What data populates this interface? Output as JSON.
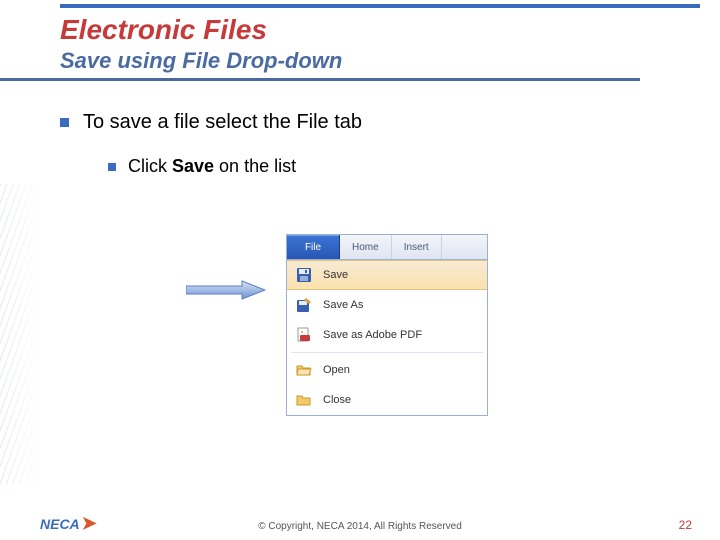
{
  "title": "Electronic Files",
  "subtitle": "Save using File Drop-down",
  "bullet1": "To save a file select the File tab",
  "bullet2_pre": "Click ",
  "bullet2_bold": "Save",
  "bullet2_post": " on the list",
  "ribbon": {
    "file": "File",
    "home": "Home",
    "insert": "Insert"
  },
  "menu": {
    "save": "Save",
    "saveas": "Save As",
    "savepdf": "Save as Adobe PDF",
    "open": "Open",
    "close": "Close"
  },
  "footer": "© Copyright, NECA 2014, All Rights Reserved",
  "page": "22",
  "logo": "NECA"
}
